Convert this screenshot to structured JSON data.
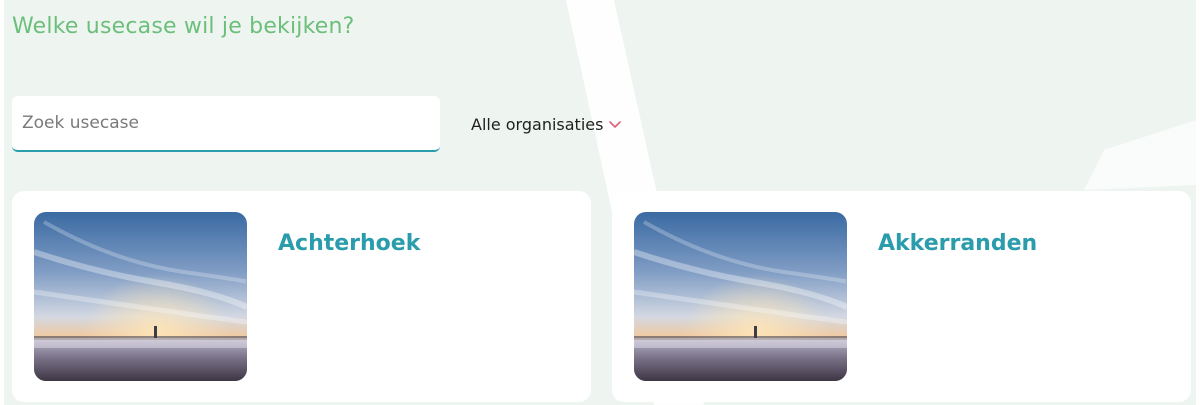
{
  "page": {
    "heading": "Welke usecase wil je bekijken?"
  },
  "search": {
    "placeholder": "Zoek usecase",
    "value": ""
  },
  "filter": {
    "selected": "Alle organisaties",
    "icon": "chevron-down-icon"
  },
  "cards": [
    {
      "title": "Achterhoek",
      "image": "misty-field-landscape"
    },
    {
      "title": "Akkerranden",
      "image": "misty-field-landscape"
    }
  ],
  "colors": {
    "heading": "#6cbf7a",
    "accent": "#2a9cac",
    "chevron": "#e0607a",
    "background": "#eef5f1"
  }
}
